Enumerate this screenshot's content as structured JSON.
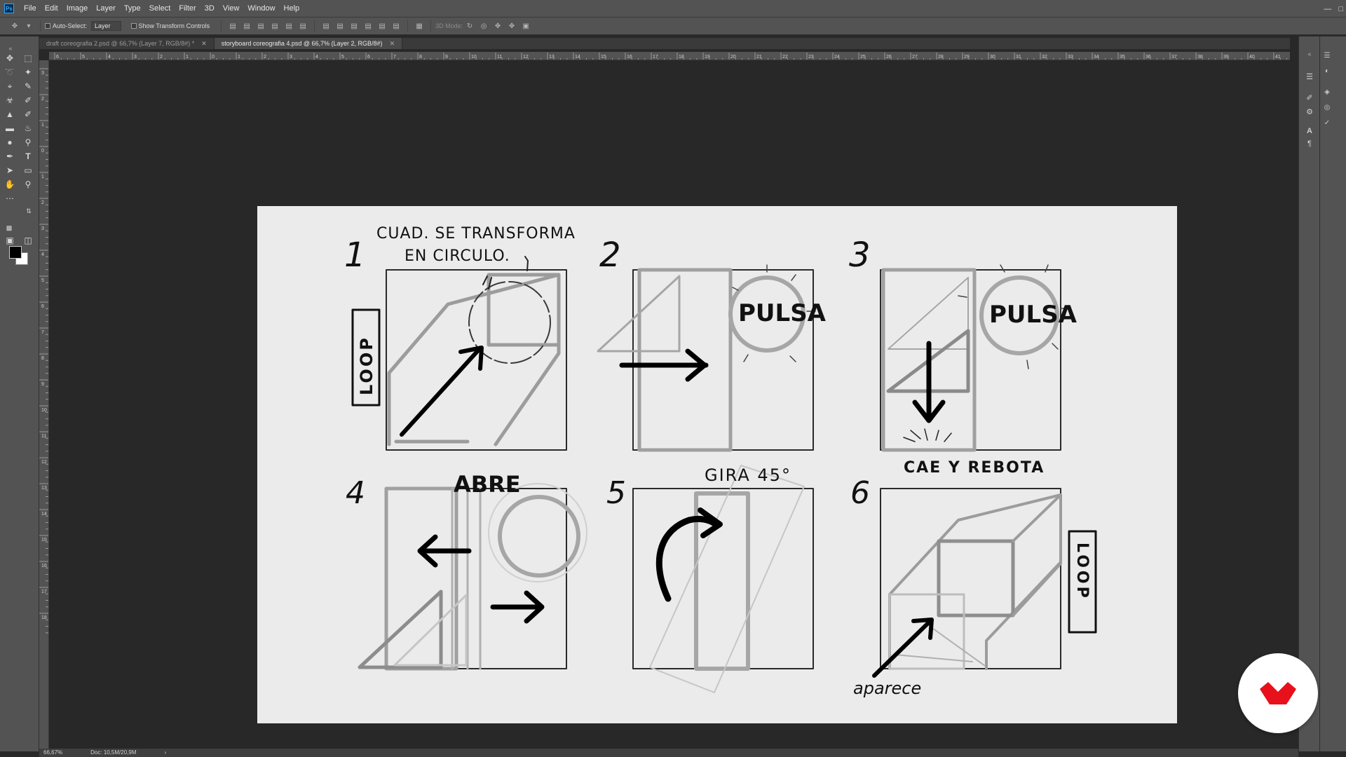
{
  "app": {
    "logo": "Ps",
    "colors": {
      "accent": "#31a8ff",
      "brand": "#e8101a"
    }
  },
  "menu": [
    "File",
    "Edit",
    "Image",
    "Layer",
    "Type",
    "Select",
    "Filter",
    "3D",
    "View",
    "Window",
    "Help"
  ],
  "options_bar": {
    "auto_select_label": "Auto-Select:",
    "auto_select_value": "Layer",
    "show_transform_label": "Show Transform Controls",
    "mode_3d_label": "3D Mode:"
  },
  "tabs": [
    {
      "label": "draft coreografia 2.psd @ 66,7% (Layer 7, RGB/8#) *",
      "active": false
    },
    {
      "label": "storyboard coreografia 4.psd @ 66,7% (Layer 2, RGB/8#)",
      "active": true
    }
  ],
  "ruler_top_labels": [
    "6",
    "5",
    "4",
    "3",
    "2",
    "1",
    "0",
    "1",
    "2",
    "3",
    "4",
    "5",
    "6",
    "7",
    "8",
    "9",
    "10",
    "11",
    "12",
    "13",
    "14",
    "15",
    "16",
    "17",
    "18",
    "19",
    "20",
    "21",
    "22",
    "23",
    "24",
    "25",
    "26",
    "27",
    "28",
    "29",
    "30",
    "31",
    "32",
    "33",
    "34",
    "35",
    "36",
    "37",
    "38",
    "39",
    "40",
    "41"
  ],
  "ruler_left_labels": [
    "3",
    "2",
    "1",
    "0",
    "1",
    "2",
    "3",
    "4",
    "5",
    "6",
    "7",
    "8",
    "9",
    "10",
    "11",
    "12",
    "13",
    "14",
    "15",
    "16",
    "17",
    "18"
  ],
  "storyboard": {
    "panel_numbers": [
      "1",
      "2",
      "3",
      "4",
      "5",
      "6"
    ],
    "note_1_line1": "CUAD. SE TRANSFORMA",
    "note_1_line2": "EN CIRCULO.",
    "loop_label": "LOOP",
    "pulsa_2": "PULSA",
    "pulsa_3": "PULSA",
    "cae_label": "CAE Y REBOTA",
    "abre_label": "ABRE",
    "gira_label": "GIRA 45°",
    "loop_label_6": "LOOP",
    "aparece_label": "aparece"
  },
  "status": {
    "zoom": "66,67%",
    "doc": "Doc: 10,5M/20,9M"
  }
}
